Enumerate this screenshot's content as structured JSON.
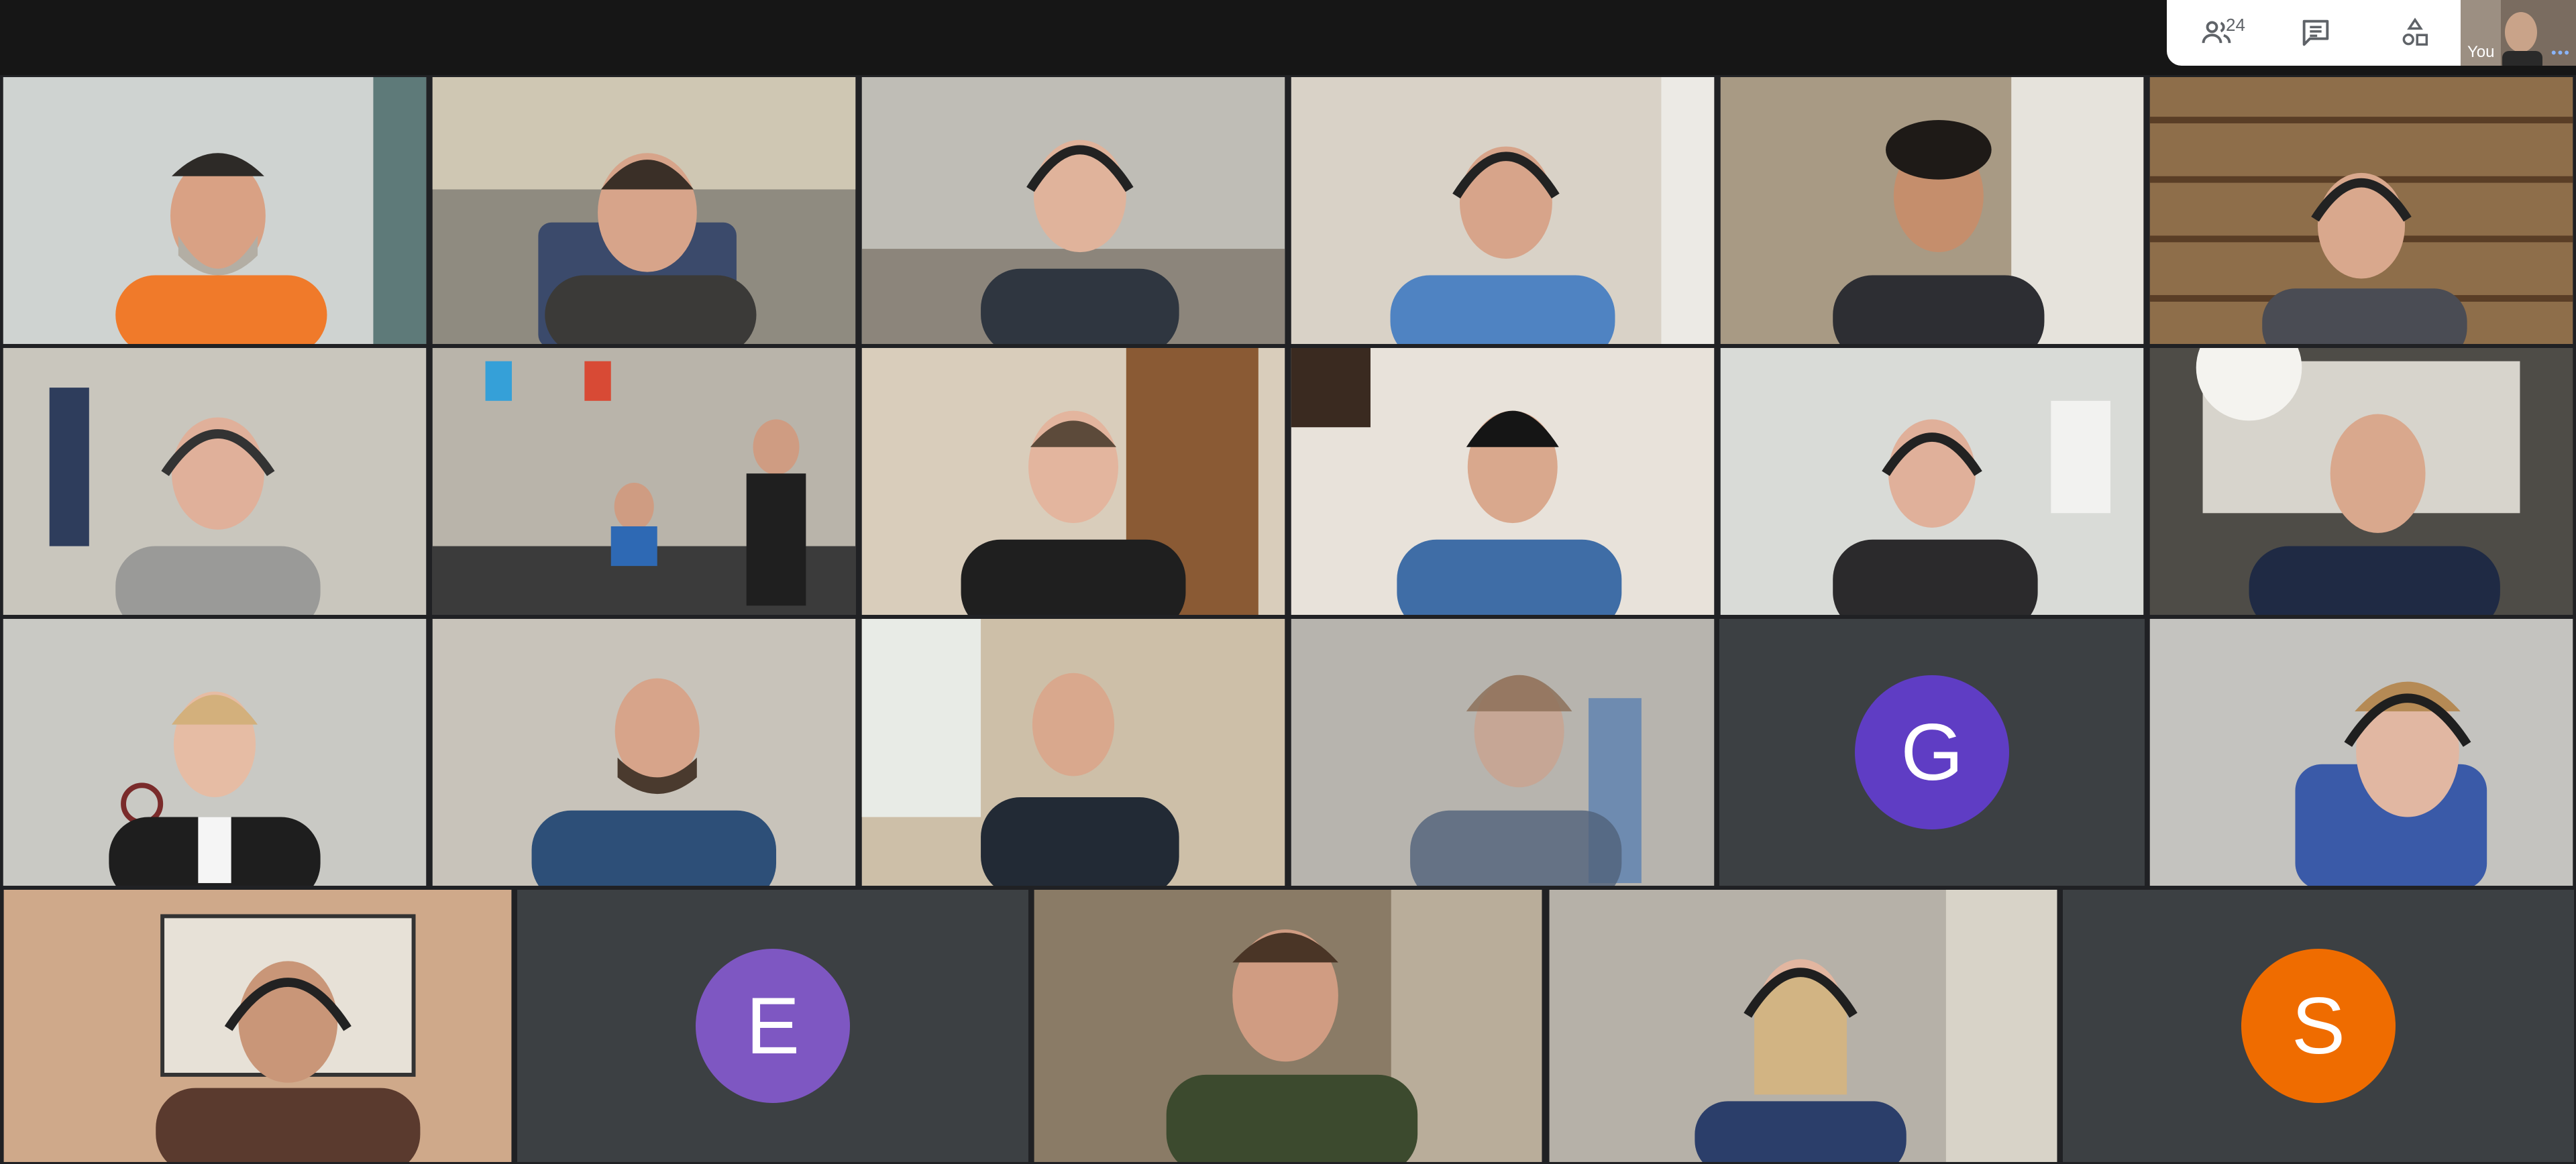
{
  "app": {
    "name": "Video meeting grid view"
  },
  "controls": {
    "people_icon": "people-icon",
    "participant_count": "24",
    "chat_icon": "chat-icon",
    "activities_icon": "shapes-icon"
  },
  "self_view": {
    "label": "You",
    "more_icon": "more-dots-icon"
  },
  "participants": [
    {
      "row": 1,
      "type": "video",
      "scene": "orange-hoodie-cap",
      "bg": "#cfd3d1"
    },
    {
      "row": 1,
      "type": "video",
      "scene": "office-dark-hoodie",
      "bg": "#8f8b80"
    },
    {
      "row": 1,
      "type": "video",
      "scene": "attic-headset",
      "bg": "#bfbdb6"
    },
    {
      "row": 1,
      "type": "video",
      "scene": "white-wall-headset",
      "bg": "#d9d2c7"
    },
    {
      "row": 1,
      "type": "video",
      "scene": "curly-hair-plant",
      "bg": "#a89a84"
    },
    {
      "row": 1,
      "type": "video",
      "scene": "bookshelf",
      "bg": "#8e6e4a"
    },
    {
      "row": 2,
      "type": "video",
      "scene": "grey-hoodie-headset",
      "bg": "#c9c6bd"
    },
    {
      "row": 2,
      "type": "video",
      "scene": "office-group",
      "bg": "#b9b4aa"
    },
    {
      "row": 2,
      "type": "video",
      "scene": "wooden-cabinet",
      "bg": "#d9cdbb"
    },
    {
      "row": 2,
      "type": "video",
      "scene": "beanie-white-panels",
      "bg": "#e8e2da"
    },
    {
      "row": 2,
      "type": "video",
      "scene": "white-room-headset",
      "bg": "#d9dbd7"
    },
    {
      "row": 2,
      "type": "video",
      "scene": "bald-projector",
      "bg": "#4e4c47"
    },
    {
      "row": 3,
      "type": "video",
      "scene": "woman-headset",
      "bg": "#c9c9c4"
    },
    {
      "row": 3,
      "type": "video",
      "scene": "glasses-blue-shirt",
      "bg": "#c8c3ba"
    },
    {
      "row": 3,
      "type": "video",
      "scene": "window-plant-headset",
      "bg": "#cdbfa8"
    },
    {
      "row": 3,
      "type": "video",
      "scene": "faded-blue-chair",
      "bg": "#b7b4ae"
    },
    {
      "row": 3,
      "type": "avatar",
      "initial": "G",
      "color": "#5f3dc4"
    },
    {
      "row": 3,
      "type": "video",
      "scene": "headset-closeup",
      "bg": "#c4c3bf"
    },
    {
      "row": 4,
      "type": "video",
      "scene": "pictures-wall",
      "bg": "#cfa98a"
    },
    {
      "row": 4,
      "type": "avatar",
      "initial": "E",
      "color": "#7e57c2"
    },
    {
      "row": 4,
      "type": "video",
      "scene": "green-hoodie",
      "bg": "#8a7b66"
    },
    {
      "row": 4,
      "type": "video",
      "scene": "woman-mic-headset",
      "bg": "#b6b1a8"
    },
    {
      "row": 4,
      "type": "avatar",
      "initial": "S",
      "color": "#ef6c00"
    }
  ]
}
